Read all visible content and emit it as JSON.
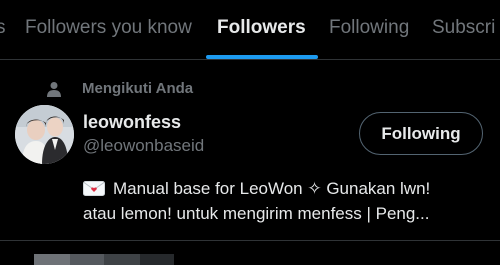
{
  "tabs": [
    {
      "label": "s",
      "active": false
    },
    {
      "label": "Followers you know",
      "active": false
    },
    {
      "label": "Followers",
      "active": true
    },
    {
      "label": "Following",
      "active": false
    },
    {
      "label": "Subscri",
      "active": false
    }
  ],
  "accent_color": "#1d9bf0",
  "user_card": {
    "context_icon": "person-icon",
    "context_label": "Mengikuti Anda",
    "name": "leowonfess",
    "handle": "@leowonbaseid",
    "follow_button_label": "Following",
    "bio_icon": "envelope-icon",
    "bio_line1": "Manual base for LeoWon ✧ Gunakan lwn!",
    "bio_line2": "atau lemon! untuk mengirim menfess | Peng..."
  }
}
